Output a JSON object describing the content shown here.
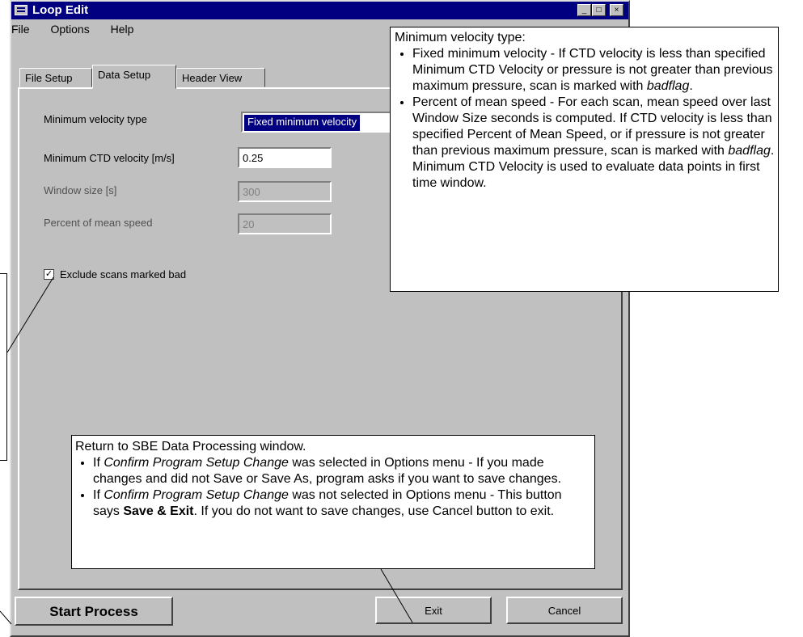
{
  "window": {
    "title": "Loop Edit"
  },
  "menu": [
    "File",
    "Options",
    "Help"
  ],
  "tabs": [
    "File Setup",
    "Data Setup",
    "Header View"
  ],
  "form": {
    "min_velocity_type_label": "Minimum velocity type",
    "min_velocity_type_value": "Fixed minimum velocity",
    "min_ctd_velocity_label": "Minimum CTD velocity [m/s]",
    "min_ctd_velocity_value": "0.25",
    "window_size_label": "Window size [s]",
    "window_size_value": "300",
    "percent_mean_speed_label": "Percent of mean speed",
    "percent_mean_speed_value": "20",
    "exclude_label": "Exclude scans marked bad",
    "exclude_checked": true
  },
  "buttons": {
    "start": "Start Process",
    "exit": "Exit",
    "cancel": "Cancel"
  },
  "callout_top": {
    "heading": "Minimum velocity type:",
    "b1": [
      "Fixed minimum velocity - If CTD velocity is less than specified Minimum CTD Velocity or pressure is not greater than previous maximum pressure, scan is marked with ",
      "badflag",
      "."
    ],
    "b2": [
      "Percent of mean speed - For each scan, mean speed over last Window Size seconds is computed. If CTD velocity is less than specified Percent of Mean Speed, or if pressure is not greater than previous maximum pressure, scan is marked with ",
      "badflag",
      ". Minimum CTD Velocity is used to evaluate data points in first time window."
    ]
  },
  "callout_bottom": {
    "heading": "Return to SBE Data Processing window.",
    "b1": [
      "If ",
      "Confirm Program Setup Change",
      " was selected in Options menu - If you made changes and did not Save or Save As, program asks if you want to save changes."
    ],
    "b2": [
      "If ",
      "Confirm Program Setup Change",
      " was not selected in Options menu - This button says ",
      "Save & Exit",
      ". If you do not want to save changes, use Cancel button to exit."
    ]
  }
}
